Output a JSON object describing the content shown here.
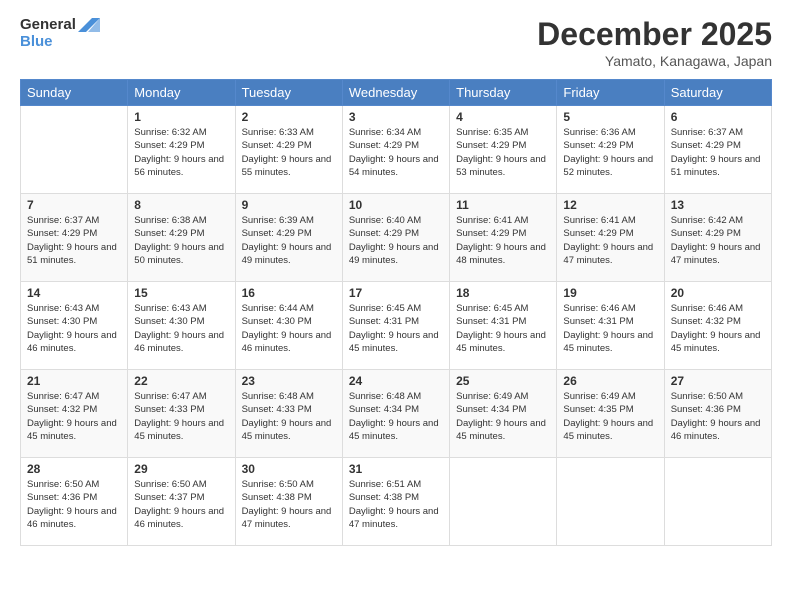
{
  "logo": {
    "line1": "General",
    "line2": "Blue"
  },
  "title": "December 2025",
  "location": "Yamato, Kanagawa, Japan",
  "days_of_week": [
    "Sunday",
    "Monday",
    "Tuesday",
    "Wednesday",
    "Thursday",
    "Friday",
    "Saturday"
  ],
  "weeks": [
    [
      {
        "day": "",
        "sunrise": "",
        "sunset": "",
        "daylight": ""
      },
      {
        "day": "1",
        "sunrise": "Sunrise: 6:32 AM",
        "sunset": "Sunset: 4:29 PM",
        "daylight": "Daylight: 9 hours and 56 minutes."
      },
      {
        "day": "2",
        "sunrise": "Sunrise: 6:33 AM",
        "sunset": "Sunset: 4:29 PM",
        "daylight": "Daylight: 9 hours and 55 minutes."
      },
      {
        "day": "3",
        "sunrise": "Sunrise: 6:34 AM",
        "sunset": "Sunset: 4:29 PM",
        "daylight": "Daylight: 9 hours and 54 minutes."
      },
      {
        "day": "4",
        "sunrise": "Sunrise: 6:35 AM",
        "sunset": "Sunset: 4:29 PM",
        "daylight": "Daylight: 9 hours and 53 minutes."
      },
      {
        "day": "5",
        "sunrise": "Sunrise: 6:36 AM",
        "sunset": "Sunset: 4:29 PM",
        "daylight": "Daylight: 9 hours and 52 minutes."
      },
      {
        "day": "6",
        "sunrise": "Sunrise: 6:37 AM",
        "sunset": "Sunset: 4:29 PM",
        "daylight": "Daylight: 9 hours and 51 minutes."
      }
    ],
    [
      {
        "day": "7",
        "sunrise": "Sunrise: 6:37 AM",
        "sunset": "Sunset: 4:29 PM",
        "daylight": "Daylight: 9 hours and 51 minutes."
      },
      {
        "day": "8",
        "sunrise": "Sunrise: 6:38 AM",
        "sunset": "Sunset: 4:29 PM",
        "daylight": "Daylight: 9 hours and 50 minutes."
      },
      {
        "day": "9",
        "sunrise": "Sunrise: 6:39 AM",
        "sunset": "Sunset: 4:29 PM",
        "daylight": "Daylight: 9 hours and 49 minutes."
      },
      {
        "day": "10",
        "sunrise": "Sunrise: 6:40 AM",
        "sunset": "Sunset: 4:29 PM",
        "daylight": "Daylight: 9 hours and 49 minutes."
      },
      {
        "day": "11",
        "sunrise": "Sunrise: 6:41 AM",
        "sunset": "Sunset: 4:29 PM",
        "daylight": "Daylight: 9 hours and 48 minutes."
      },
      {
        "day": "12",
        "sunrise": "Sunrise: 6:41 AM",
        "sunset": "Sunset: 4:29 PM",
        "daylight": "Daylight: 9 hours and 47 minutes."
      },
      {
        "day": "13",
        "sunrise": "Sunrise: 6:42 AM",
        "sunset": "Sunset: 4:29 PM",
        "daylight": "Daylight: 9 hours and 47 minutes."
      }
    ],
    [
      {
        "day": "14",
        "sunrise": "Sunrise: 6:43 AM",
        "sunset": "Sunset: 4:30 PM",
        "daylight": "Daylight: 9 hours and 46 minutes."
      },
      {
        "day": "15",
        "sunrise": "Sunrise: 6:43 AM",
        "sunset": "Sunset: 4:30 PM",
        "daylight": "Daylight: 9 hours and 46 minutes."
      },
      {
        "day": "16",
        "sunrise": "Sunrise: 6:44 AM",
        "sunset": "Sunset: 4:30 PM",
        "daylight": "Daylight: 9 hours and 46 minutes."
      },
      {
        "day": "17",
        "sunrise": "Sunrise: 6:45 AM",
        "sunset": "Sunset: 4:31 PM",
        "daylight": "Daylight: 9 hours and 45 minutes."
      },
      {
        "day": "18",
        "sunrise": "Sunrise: 6:45 AM",
        "sunset": "Sunset: 4:31 PM",
        "daylight": "Daylight: 9 hours and 45 minutes."
      },
      {
        "day": "19",
        "sunrise": "Sunrise: 6:46 AM",
        "sunset": "Sunset: 4:31 PM",
        "daylight": "Daylight: 9 hours and 45 minutes."
      },
      {
        "day": "20",
        "sunrise": "Sunrise: 6:46 AM",
        "sunset": "Sunset: 4:32 PM",
        "daylight": "Daylight: 9 hours and 45 minutes."
      }
    ],
    [
      {
        "day": "21",
        "sunrise": "Sunrise: 6:47 AM",
        "sunset": "Sunset: 4:32 PM",
        "daylight": "Daylight: 9 hours and 45 minutes."
      },
      {
        "day": "22",
        "sunrise": "Sunrise: 6:47 AM",
        "sunset": "Sunset: 4:33 PM",
        "daylight": "Daylight: 9 hours and 45 minutes."
      },
      {
        "day": "23",
        "sunrise": "Sunrise: 6:48 AM",
        "sunset": "Sunset: 4:33 PM",
        "daylight": "Daylight: 9 hours and 45 minutes."
      },
      {
        "day": "24",
        "sunrise": "Sunrise: 6:48 AM",
        "sunset": "Sunset: 4:34 PM",
        "daylight": "Daylight: 9 hours and 45 minutes."
      },
      {
        "day": "25",
        "sunrise": "Sunrise: 6:49 AM",
        "sunset": "Sunset: 4:34 PM",
        "daylight": "Daylight: 9 hours and 45 minutes."
      },
      {
        "day": "26",
        "sunrise": "Sunrise: 6:49 AM",
        "sunset": "Sunset: 4:35 PM",
        "daylight": "Daylight: 9 hours and 45 minutes."
      },
      {
        "day": "27",
        "sunrise": "Sunrise: 6:50 AM",
        "sunset": "Sunset: 4:36 PM",
        "daylight": "Daylight: 9 hours and 46 minutes."
      }
    ],
    [
      {
        "day": "28",
        "sunrise": "Sunrise: 6:50 AM",
        "sunset": "Sunset: 4:36 PM",
        "daylight": "Daylight: 9 hours and 46 minutes."
      },
      {
        "day": "29",
        "sunrise": "Sunrise: 6:50 AM",
        "sunset": "Sunset: 4:37 PM",
        "daylight": "Daylight: 9 hours and 46 minutes."
      },
      {
        "day": "30",
        "sunrise": "Sunrise: 6:50 AM",
        "sunset": "Sunset: 4:38 PM",
        "daylight": "Daylight: 9 hours and 47 minutes."
      },
      {
        "day": "31",
        "sunrise": "Sunrise: 6:51 AM",
        "sunset": "Sunset: 4:38 PM",
        "daylight": "Daylight: 9 hours and 47 minutes."
      },
      {
        "day": "",
        "sunrise": "",
        "sunset": "",
        "daylight": ""
      },
      {
        "day": "",
        "sunrise": "",
        "sunset": "",
        "daylight": ""
      },
      {
        "day": "",
        "sunrise": "",
        "sunset": "",
        "daylight": ""
      }
    ]
  ]
}
